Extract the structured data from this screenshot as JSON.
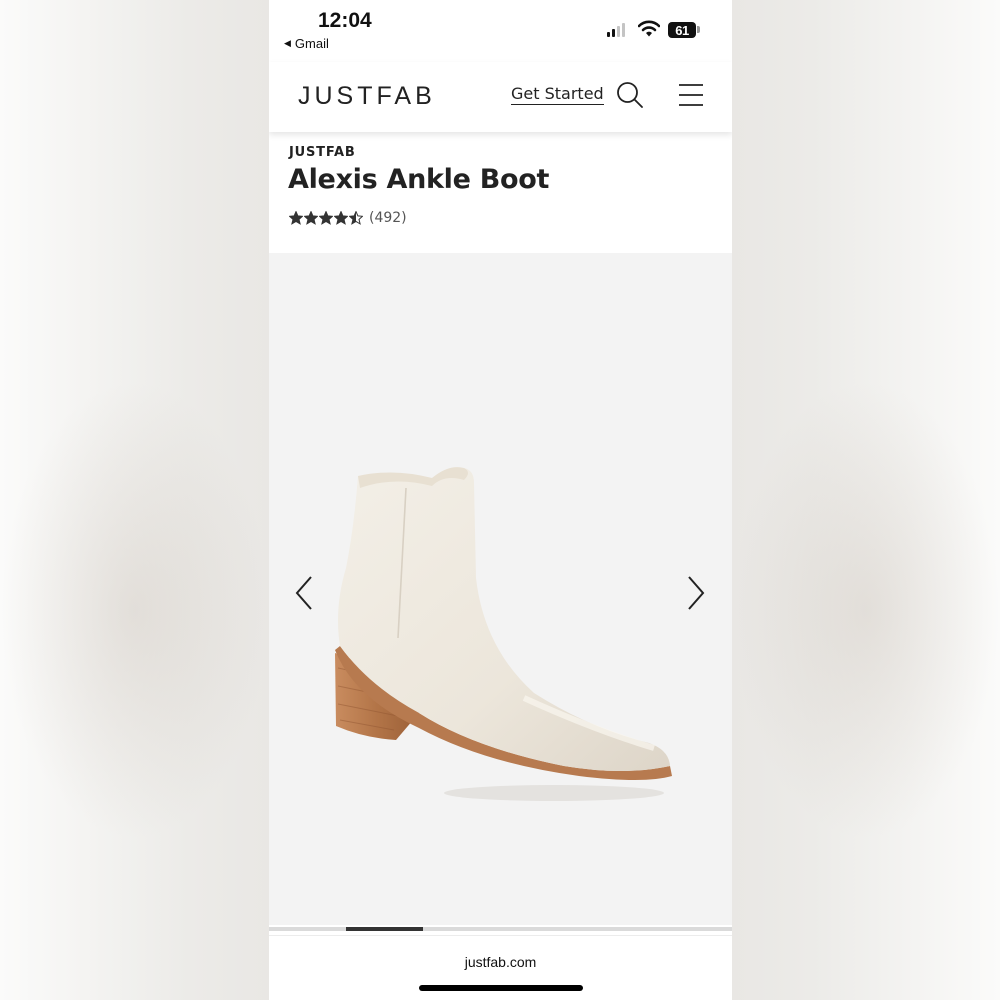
{
  "status_bar": {
    "time": "12:04",
    "back_app": "Gmail",
    "battery": "61",
    "signal_icon": "cellular-signal-icon",
    "wifi_icon": "wifi-icon"
  },
  "header": {
    "logo": "JUSTFAB",
    "get_started": "Get Started",
    "search_icon": "search-icon",
    "menu_icon": "hamburger-menu-icon"
  },
  "product": {
    "brand": "JUSTFAB",
    "title": "Alexis Ankle Boot",
    "rating": 4.5,
    "reviews": "(492)"
  },
  "gallery": {
    "image": "cream-ankle-boot-image",
    "progress": 0.1667
  },
  "browser": {
    "url": "justfab.com"
  },
  "colors": {
    "text": "#222222",
    "boot_leather": "#efe9df",
    "heel_wood": "#b77a4f",
    "image_bg": "#f3f3f3"
  }
}
